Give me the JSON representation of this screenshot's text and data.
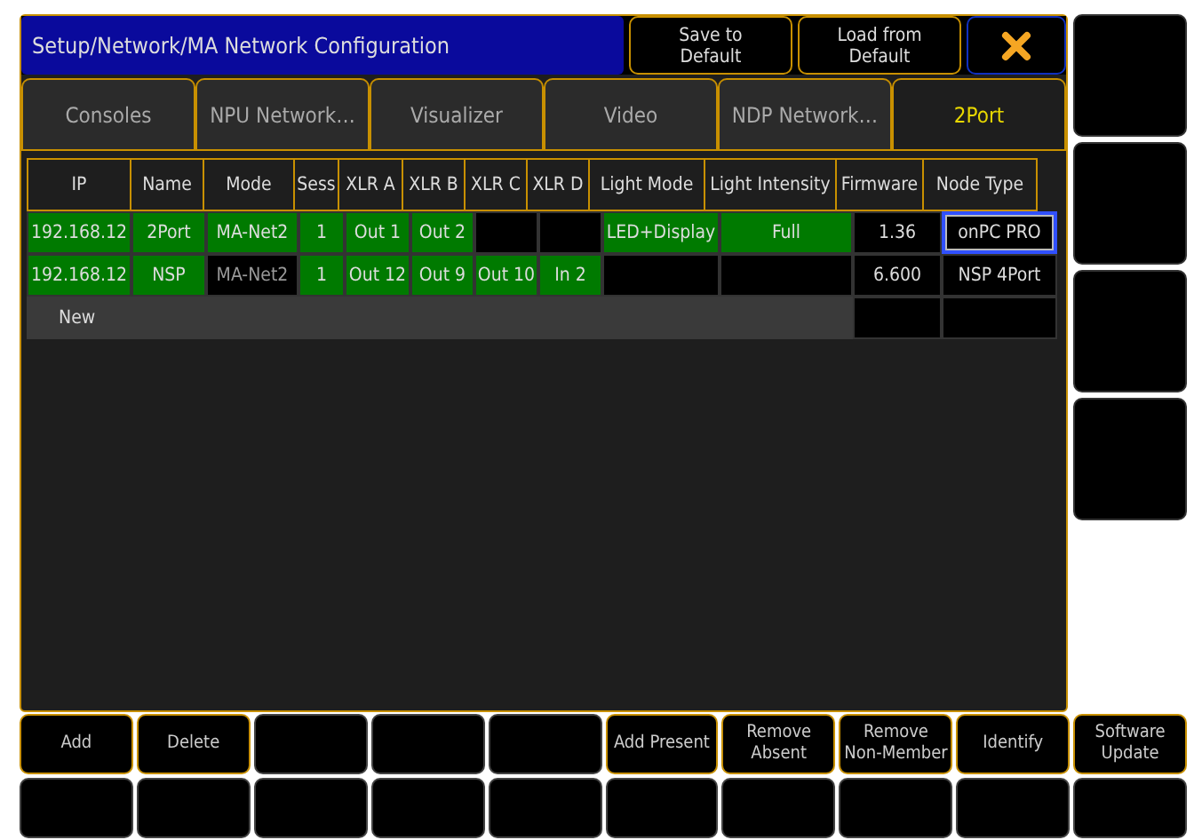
{
  "window": {
    "title": "Setup/Network/MA Network Configuration"
  },
  "header_buttons": [
    "Save to Default",
    "Load from Default"
  ],
  "tabs": [
    {
      "label": "Consoles",
      "selected": false
    },
    {
      "label": "NPU Network…",
      "selected": false
    },
    {
      "label": "Visualizer",
      "selected": false
    },
    {
      "label": "Video",
      "selected": false
    },
    {
      "label": "NDP Network…",
      "selected": false
    },
    {
      "label": "2Port",
      "selected": true
    }
  ],
  "table": {
    "columns": [
      "IP",
      "Name",
      "Mode",
      "Sess",
      "XLR A",
      "XLR B",
      "XLR C",
      "XLR D",
      "Light Mode",
      "Light Intensity",
      "Firmware",
      "Node Type"
    ],
    "rows": [
      {
        "cells": [
          {
            "text": "192.168.12",
            "active": true,
            "focused": false
          },
          {
            "text": "2Port",
            "active": true,
            "focused": false
          },
          {
            "text": "MA-Net2",
            "active": true,
            "focused": false
          },
          {
            "text": "1",
            "active": true,
            "focused": false
          },
          {
            "text": "Out 1",
            "active": true,
            "focused": false
          },
          {
            "text": "Out 2",
            "active": true,
            "focused": false
          },
          {
            "active": false,
            "focused": false
          },
          {
            "active": false,
            "focused": false
          },
          {
            "text": "LED+Display",
            "active": true,
            "focused": false
          },
          {
            "text": "Full",
            "active": true,
            "focused": false
          },
          {
            "text": "1.36",
            "active": false,
            "focused": false
          },
          {
            "text": "onPC PRO",
            "active": false,
            "focused": true
          }
        ]
      },
      {
        "cells": [
          {
            "text": "192.168.12",
            "active": true,
            "focused": false
          },
          {
            "text": "NSP",
            "active": true,
            "focused": false
          },
          {
            "text": "MA-Net2",
            "active": false,
            "focused": false
          },
          {
            "text": "1",
            "active": true,
            "focused": false
          },
          {
            "text": "Out 12",
            "active": true,
            "focused": false
          },
          {
            "text": "Out 9",
            "active": true,
            "focused": false
          },
          {
            "text": "Out 10",
            "active": true,
            "focused": false
          },
          {
            "text": "In 2",
            "active": true,
            "focused": false
          },
          {
            "active": false,
            "focused": false
          },
          {
            "active": false,
            "focused": false
          },
          {
            "text": "6.600",
            "active": false,
            "focused": false
          },
          {
            "text": "NSP 4Port",
            "active": false,
            "focused": false
          }
        ]
      }
    ],
    "new_row": "New"
  },
  "keys": [
    {
      "label": "Add",
      "enabled": true
    },
    {
      "label": "Delete",
      "enabled": true
    },
    {
      "enabled": false
    },
    {
      "enabled": false
    },
    {
      "enabled": false
    },
    {
      "label": "Add Present",
      "enabled": true
    },
    {
      "label": "Remove Absent",
      "enabled": true
    },
    {
      "label": "Remove Non-Member",
      "enabled": true
    },
    {
      "label": "Identify",
      "enabled": true
    },
    {
      "label": "Software Update",
      "enabled": true
    },
    {
      "enabled": false
    },
    {
      "enabled": false
    },
    {
      "enabled": false
    },
    {
      "enabled": false
    },
    {
      "enabled": false
    },
    {
      "enabled": false
    },
    {
      "enabled": false
    },
    {
      "enabled": false
    },
    {
      "enabled": false
    },
    {
      "enabled": false
    }
  ]
}
